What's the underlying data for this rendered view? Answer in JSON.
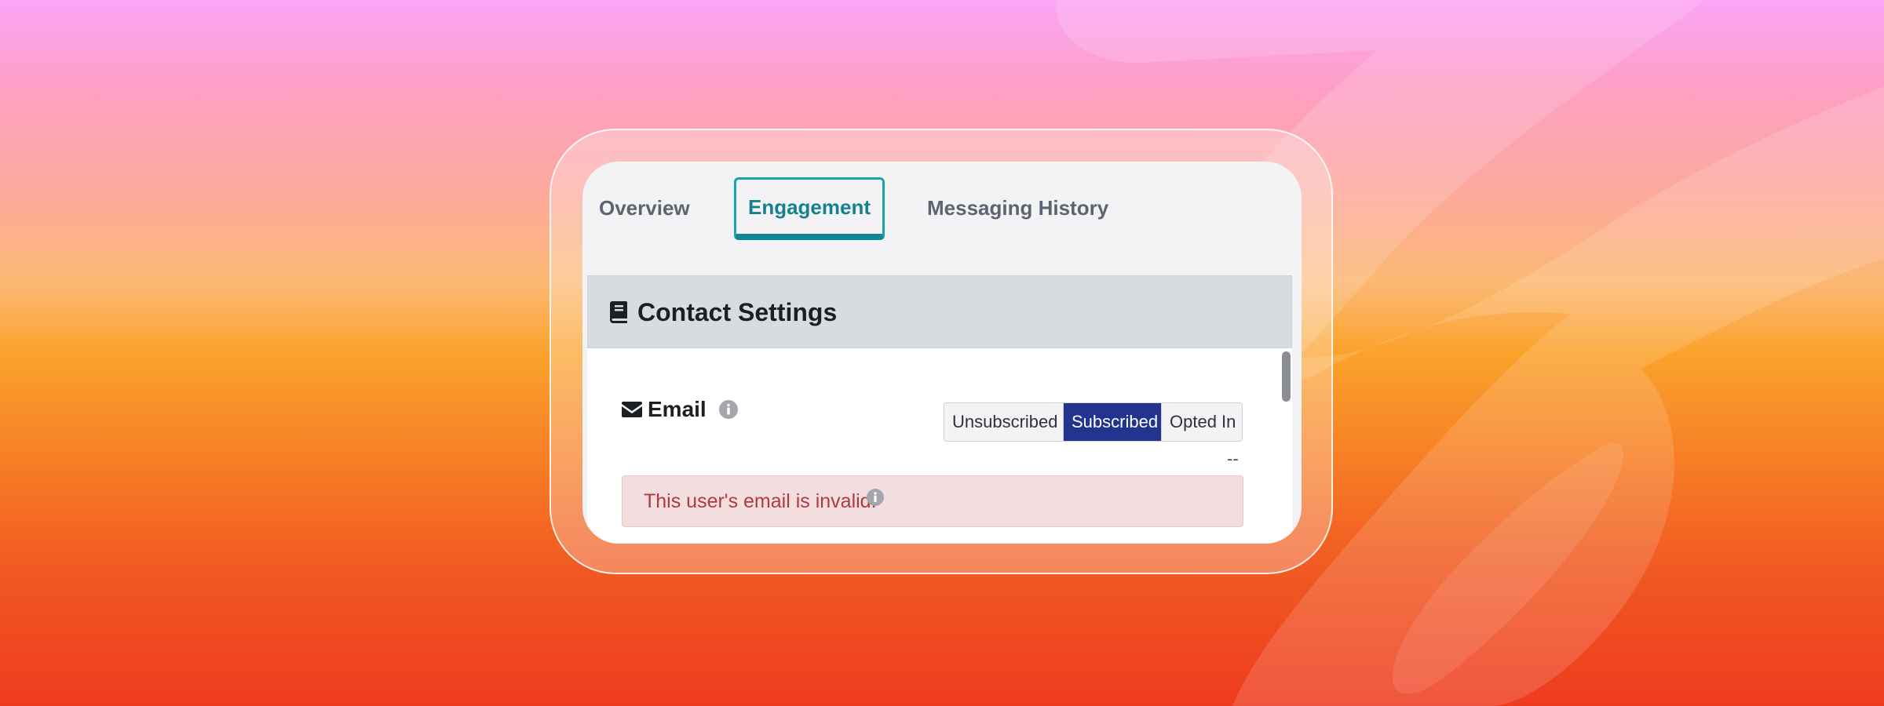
{
  "tabs": {
    "overview": "Overview",
    "engagement": "Engagement",
    "history": "Messaging History"
  },
  "panel": {
    "title": "Contact Settings",
    "icon": "book-icon"
  },
  "email": {
    "label": "Email",
    "icon": "envelope-icon",
    "info_icon": "info-icon",
    "options": [
      "Unsubscribed",
      "Subscribed",
      "Opted In"
    ],
    "selected": "Subscribed",
    "secondary_value": "--",
    "alert": "This user's email is invalid."
  },
  "colors": {
    "tab_active": "#15818f",
    "segment_active": "#22348f",
    "alert_text": "#b13a3f",
    "alert_bg": "#f2dedf"
  }
}
